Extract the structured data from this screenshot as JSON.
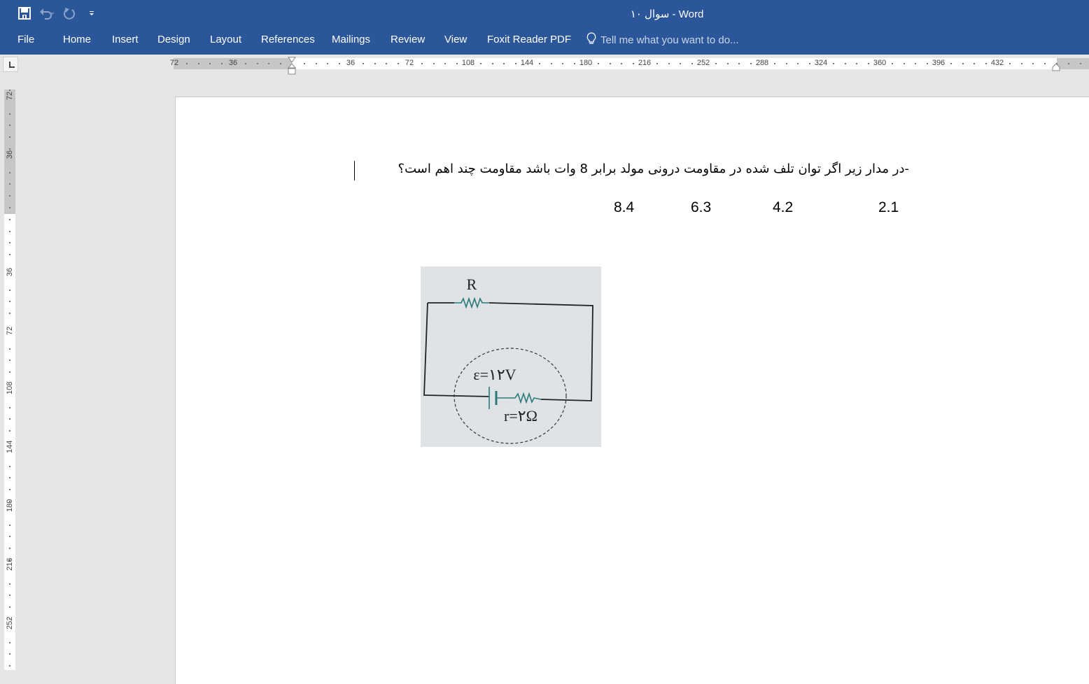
{
  "window": {
    "title": "سوال ۱۰ - Word"
  },
  "quick_access": {
    "save": "save-icon",
    "undo": "undo-icon",
    "redo": "redo-icon",
    "customize": "customize-qat-icon"
  },
  "ribbon": {
    "tabs": [
      {
        "label": "File"
      },
      {
        "label": "Home"
      },
      {
        "label": "Insert"
      },
      {
        "label": "Design"
      },
      {
        "label": "Layout"
      },
      {
        "label": "References"
      },
      {
        "label": "Mailings"
      },
      {
        "label": "Review"
      },
      {
        "label": "View"
      },
      {
        "label": "Foxit Reader PDF"
      }
    ],
    "tell_me": "Tell me what you want to do..."
  },
  "rulers": {
    "horizontal_labels": [
      "72",
      "36",
      "36",
      "72",
      "108",
      "144",
      "180",
      "216",
      "252",
      "288",
      "324",
      "360",
      "396",
      "432"
    ],
    "vertical_labels": [
      "72",
      "36",
      "36",
      "72",
      "108",
      "144",
      "180",
      "216",
      "252"
    ]
  },
  "document": {
    "question": "-در مدار زیر اگر توان تلف شده در مقاومت درونی مولد برابر 8 وات باشد مقاومت   چند اهم است؟",
    "options": [
      "2.1",
      "4.2",
      "6.3",
      "8.4"
    ],
    "figure": {
      "resistor_label": "R",
      "emf_label": "ε=۱۲V",
      "internal_resistance_label": "r=۲Ω",
      "wire_color": "#222222",
      "component_color": "#2a7a7a",
      "background_color": "#dfe3e6"
    }
  }
}
